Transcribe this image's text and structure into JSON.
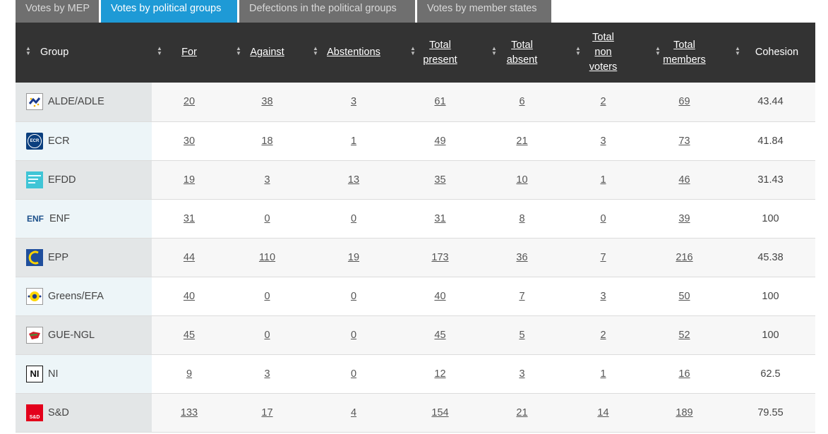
{
  "tabs": [
    {
      "label": "Votes by MEP",
      "active": false
    },
    {
      "label": "Votes by political groups",
      "active": true
    },
    {
      "label": "Defections in the political groups",
      "active": false
    },
    {
      "label": "Votes by member states",
      "active": false
    }
  ],
  "columns": {
    "group": "Group",
    "for": "For",
    "against": "Against",
    "abstentions": "Abstentions",
    "total_present": [
      "Total",
      "present"
    ],
    "total_absent": [
      "Total",
      "absent"
    ],
    "total_non_voters": [
      "Total",
      "non",
      "voters"
    ],
    "total_members": [
      "Total",
      "members"
    ],
    "cohesion": "Cohesion"
  },
  "rows": [
    {
      "group": "ALDE/ADLE",
      "logo": "alde-logo",
      "for": "20",
      "against": "38",
      "abstentions": "3",
      "present": "61",
      "absent": "6",
      "non_voters": "2",
      "members": "69",
      "cohesion": "43.44"
    },
    {
      "group": "ECR",
      "logo": "ecr-logo",
      "logo_text": "ECR",
      "for": "30",
      "against": "18",
      "abstentions": "1",
      "present": "49",
      "absent": "21",
      "non_voters": "3",
      "members": "73",
      "cohesion": "41.84"
    },
    {
      "group": "EFDD",
      "logo": "efdd-logo",
      "for": "19",
      "against": "3",
      "abstentions": "13",
      "present": "35",
      "absent": "10",
      "non_voters": "1",
      "members": "46",
      "cohesion": "31.43"
    },
    {
      "group": "ENF",
      "logo": "enf-logo",
      "logo_text": "ENF",
      "for": "31",
      "against": "0",
      "abstentions": "0",
      "present": "31",
      "absent": "8",
      "non_voters": "0",
      "members": "39",
      "cohesion": "100"
    },
    {
      "group": "EPP",
      "logo": "epp-logo",
      "for": "44",
      "against": "110",
      "abstentions": "19",
      "present": "173",
      "absent": "36",
      "non_voters": "7",
      "members": "216",
      "cohesion": "45.38"
    },
    {
      "group": "Greens/EFA",
      "logo": "greens-logo",
      "for": "40",
      "against": "0",
      "abstentions": "0",
      "present": "40",
      "absent": "7",
      "non_voters": "3",
      "members": "50",
      "cohesion": "100"
    },
    {
      "group": "GUE-NGL",
      "logo": "gue-logo",
      "for": "45",
      "against": "0",
      "abstentions": "0",
      "present": "45",
      "absent": "5",
      "non_voters": "2",
      "members": "52",
      "cohesion": "100"
    },
    {
      "group": "NI",
      "logo": "ni-logo",
      "logo_text": "NI",
      "for": "9",
      "against": "3",
      "abstentions": "0",
      "present": "12",
      "absent": "3",
      "non_voters": "1",
      "members": "16",
      "cohesion": "62.5"
    },
    {
      "group": "S&D",
      "logo": "sd-logo",
      "logo_text": "S&D",
      "for": "133",
      "against": "17",
      "abstentions": "4",
      "present": "154",
      "absent": "21",
      "non_voters": "14",
      "members": "189",
      "cohesion": "79.55"
    }
  ],
  "colors": {
    "tab_active": "#1e9ad6",
    "tab_inactive": "#6f6f6f",
    "header_bg": "#333333",
    "group_cell_odd": "#e3e6e7",
    "group_cell_even": "#edf5f8"
  }
}
